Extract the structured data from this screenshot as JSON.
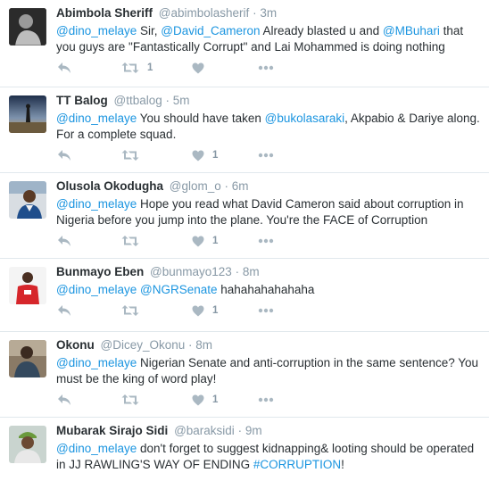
{
  "tweets": [
    {
      "name": "Abimbola Sheriff",
      "handle": "@abimbolasherif",
      "dot": "·",
      "time": "3m",
      "parts": [
        {
          "t": "@dino_melaye",
          "link": true
        },
        {
          "t": " Sir, ",
          "link": false
        },
        {
          "t": "@David_Cameron",
          "link": true
        },
        {
          "t": " Already blasted u and ",
          "link": false
        },
        {
          "t": "@MBuhari",
          "link": true
        },
        {
          "t": " that you guys are \"Fantastically Corrupt\" and Lai Mohammed is doing nothing",
          "link": false
        }
      ],
      "retweets": "1",
      "likes": ""
    },
    {
      "name": "TT Balog",
      "handle": "@ttbalog",
      "dot": "·",
      "time": "5m",
      "parts": [
        {
          "t": "@dino_melaye",
          "link": true
        },
        {
          "t": " You should have taken ",
          "link": false
        },
        {
          "t": "@bukolasaraki",
          "link": true
        },
        {
          "t": ", Akpabio & Dariye along. For a complete squad.",
          "link": false
        }
      ],
      "retweets": "",
      "likes": "1"
    },
    {
      "name": "Olusola Okodugha",
      "handle": "@glom_o",
      "dot": "·",
      "time": "6m",
      "parts": [
        {
          "t": "@dino_melaye",
          "link": true
        },
        {
          "t": " Hope you read what David Cameron said about corruption in Nigeria before you jump into the plane. You're the FACE of Corruption",
          "link": false
        }
      ],
      "retweets": "",
      "likes": "1"
    },
    {
      "name": "Bunmayo Eben",
      "handle": "@bunmayo123",
      "dot": "·",
      "time": "8m",
      "parts": [
        {
          "t": "@dino_melaye",
          "link": true
        },
        {
          "t": " ",
          "link": false
        },
        {
          "t": "@NGRSenate",
          "link": true
        },
        {
          "t": " hahahahahahaha",
          "link": false
        }
      ],
      "retweets": "",
      "likes": "1"
    },
    {
      "name": "Okonu",
      "handle": "@Dicey_Okonu",
      "dot": "·",
      "time": "8m",
      "parts": [
        {
          "t": "@dino_melaye",
          "link": true
        },
        {
          "t": " Nigerian Senate and anti-corruption in the same sentence? You must be the king of word play!",
          "link": false
        }
      ],
      "retweets": "",
      "likes": "1"
    },
    {
      "name": "Mubarak Sirajo Sidi",
      "handle": "@baraksidi",
      "dot": "·",
      "time": "9m",
      "parts": [
        {
          "t": "@dino_melaye",
          "link": true
        },
        {
          "t": " don't forget to suggest kidnapping& looting should be operated in JJ RAWLING'S WAY OF ENDING ",
          "link": false
        },
        {
          "t": "#CORRUPTION",
          "link": true
        },
        {
          "t": "!",
          "link": false
        }
      ],
      "retweets": "",
      "likes": ""
    }
  ]
}
